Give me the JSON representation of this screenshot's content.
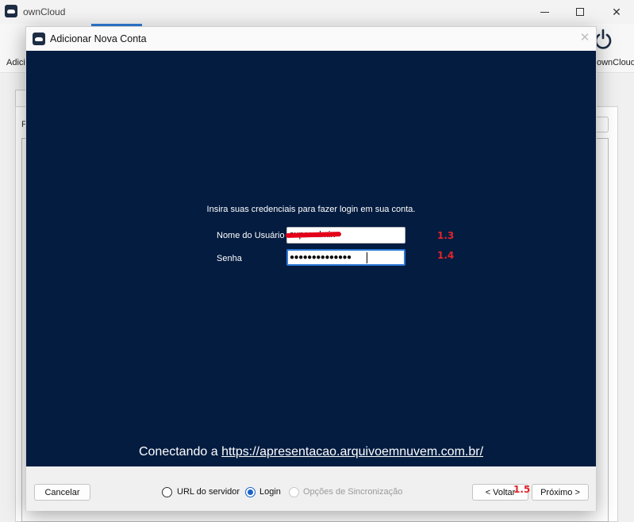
{
  "main_window": {
    "title": "ownCloud",
    "toolbar_left_label": "Adicio",
    "toolbar_right_label": "ownCloud",
    "panel_label_fragment": "P"
  },
  "dialog": {
    "title": "Adicionar Nova Conta",
    "instruction": "Insira suas credenciais para fazer login em sua conta.",
    "username_label": "Nome do Usuário",
    "username_value": "superadmin",
    "password_label": "Senha",
    "password_masked": "●●●●●●●●●●●●●●",
    "connecting_prefix": "Conectando a",
    "connecting_url": "https://apresentacao.arquivoemnuvem.com.br/",
    "cancel_label": "Cancelar",
    "steps": [
      {
        "label": "URL do servidor",
        "state": "unchecked"
      },
      {
        "label": "Login",
        "state": "checked"
      },
      {
        "label": "Opções de Sincronização",
        "state": "disabled"
      }
    ],
    "back_label": "< Voltar",
    "next_label": "Próximo >"
  },
  "annotations": {
    "username_step": "1.3",
    "password_step": "1.4",
    "back_step": "1.5"
  },
  "colors": {
    "dialog_background": "#041c40",
    "annotation": "#e3242b",
    "focus_accent": "#2d7ad6",
    "brand": "#1d2d44"
  }
}
